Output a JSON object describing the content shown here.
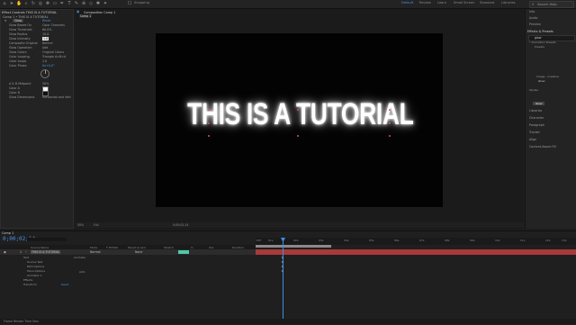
{
  "toolbar": {
    "snapping_label": "Snapping",
    "workspaces": [
      "Default",
      "Review",
      "Learn",
      "Small Screen",
      "Standard",
      "Libraries"
    ],
    "active_workspace": "Default",
    "search_placeholder": "Search Help"
  },
  "effect_controls": {
    "tab_title": "Effect Controls  THIS IS A TUTORIAL",
    "subtitle": "Comp 1 • THIS IS A TUTORIAL",
    "effect_name": "Glow",
    "reset_label": "Reset",
    "properties": [
      {
        "label": "Glow Based On",
        "value": "Color Channels"
      },
      {
        "label": "Glow Threshold",
        "value": "60.0%"
      },
      {
        "label": "Glow Radius",
        "value": "10.0"
      },
      {
        "label": "Glow Intensity",
        "value": "1.0"
      },
      {
        "label": "Composite Original",
        "value": "Behind"
      },
      {
        "label": "Glow Operation",
        "value": "Add"
      },
      {
        "label": "Glow Colors",
        "value": "Original Colors"
      },
      {
        "label": "Color Looping",
        "value": "Triangle A>B>A"
      },
      {
        "label": "Color Loops",
        "value": "1.0"
      },
      {
        "label": "Color Phase",
        "value": "0x+0.0°"
      },
      {
        "label": "A & B Midpoint",
        "value": "50%"
      },
      {
        "label": "Color A",
        "value": ""
      },
      {
        "label": "Color B",
        "value": ""
      },
      {
        "label": "Glow Dimensions",
        "value": "Horizontal and Vert"
      }
    ]
  },
  "composition": {
    "tab_title": "Composition Comp 1",
    "comp_label": "Comp 1",
    "headline": "THIS IS A TUTORIAL",
    "zoom": "50%",
    "resolution": "Full",
    "timecode": "0;00;02;14"
  },
  "right_panel": {
    "items": [
      "Info",
      "Audio",
      "Preview"
    ],
    "effects_header": "Effects & Presets",
    "effects_search": "glow",
    "tree": [
      "* Animation Presets",
      "Presets",
      "Image - Creative",
      "Glow",
      "Stylize",
      "Glow"
    ],
    "lower_items": [
      "Libraries",
      "Character",
      "Paragraph",
      "Tracker",
      "Align",
      "Content-Aware Fill"
    ]
  },
  "timeline": {
    "tab": "Comp 1",
    "timecode": "0;00;02;14",
    "columns": [
      "Source Name",
      "Mode",
      "T TrkMat",
      "Parent & Link",
      "Stretch",
      "In",
      "Out",
      "Duration"
    ],
    "layer": {
      "index": "1",
      "name": "THIS IS A TUTORIAL",
      "mode": "Normal",
      "parent": "None"
    },
    "sub_rows": [
      "Text",
      "Source Text",
      "Path Options",
      "More Options",
      "Animator 1",
      "Effects",
      "Transform"
    ],
    "animate_label": "Animate:",
    "add_label": "Add:",
    "reset_label": "Reset",
    "ticks": [
      ":00f",
      "01s",
      "02s",
      "03s",
      "04s",
      "05s",
      "06s",
      "07s",
      "08s",
      "09s",
      "10s",
      "11s",
      "12s",
      "13s",
      "14s"
    ],
    "status": "Frame Render Time  0ms"
  }
}
